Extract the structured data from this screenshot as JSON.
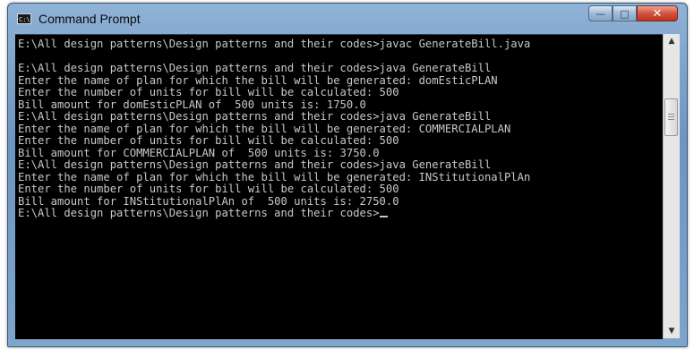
{
  "window": {
    "title": "Command Prompt",
    "icon": "console-icon",
    "icon_glyph": "C:\\"
  },
  "controls": {
    "minimize_icon": "minimize-icon",
    "maximize_icon": "maximize-icon",
    "close_icon": "close-icon",
    "minimize_glyph": "—",
    "maximize_glyph": "□",
    "close_glyph": "✕"
  },
  "console": {
    "lines": [
      "E:\\All design patterns\\Design patterns and their codes>javac GenerateBill.java",
      "",
      "E:\\All design patterns\\Design patterns and their codes>java GenerateBill",
      "Enter the name of plan for which the bill will be generated: domEsticPLAN",
      "Enter the number of units for bill will be calculated: 500",
      "Bill amount for domEsticPLAN of  500 units is: 1750.0",
      "E:\\All design patterns\\Design patterns and their codes>java GenerateBill",
      "Enter the name of plan for which the bill will be generated: COMMERCIALPLAN",
      "Enter the number of units for bill will be calculated: 500",
      "Bill amount for COMMERCIALPLAN of  500 units is: 3750.0",
      "E:\\All design patterns\\Design patterns and their codes>java GenerateBill",
      "Enter the name of plan for which the bill will be generated: INStitutionalPlAn",
      "Enter the number of units for bill will be calculated: 500",
      "Bill amount for INStitutionalPlAn of  500 units is: 2750.0",
      "E:\\All design patterns\\Design patterns and their codes>"
    ],
    "text_color": "#c8c8c8",
    "background": "#000000"
  },
  "scrollbar": {
    "up_glyph": "▲",
    "down_glyph": "▼"
  }
}
